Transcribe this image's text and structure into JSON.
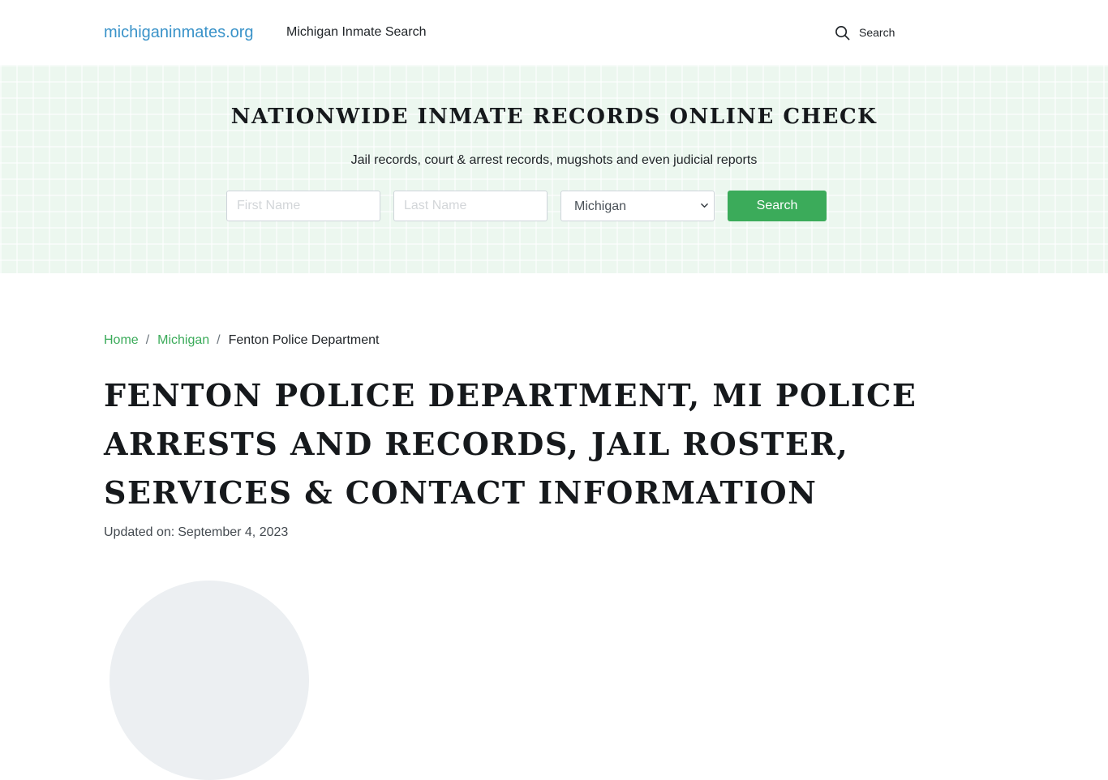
{
  "header": {
    "logo": "michiganinmates.org",
    "nav_link": "Michigan Inmate Search",
    "search_label": "Search"
  },
  "hero": {
    "title": "NATIONWIDE INMATE RECORDS ONLINE CHECK",
    "subtitle": "Jail records, court & arrest records, mugshots and even judicial reports",
    "first_name_placeholder": "First Name",
    "last_name_placeholder": "Last Name",
    "state_selected": "Michigan",
    "search_button": "Search"
  },
  "breadcrumb": {
    "items": [
      "Home",
      "Michigan",
      "Fenton Police Department"
    ],
    "separator": "/"
  },
  "page": {
    "title": "FENTON POLICE DEPARTMENT, MI POLICE ARRESTS AND RECORDS, JAIL ROSTER, SERVICES & CONTACT INFORMATION",
    "updated_label": "Updated on:",
    "updated_date": "September 4, 2023"
  },
  "colors": {
    "logo": "#3a93c9",
    "accent_green": "#3bab5a",
    "hero_background": "#ecf7ef",
    "title_text": "#16191c"
  },
  "icons": {
    "header_search": "search-icon",
    "state_select": "chevron-down-icon"
  }
}
